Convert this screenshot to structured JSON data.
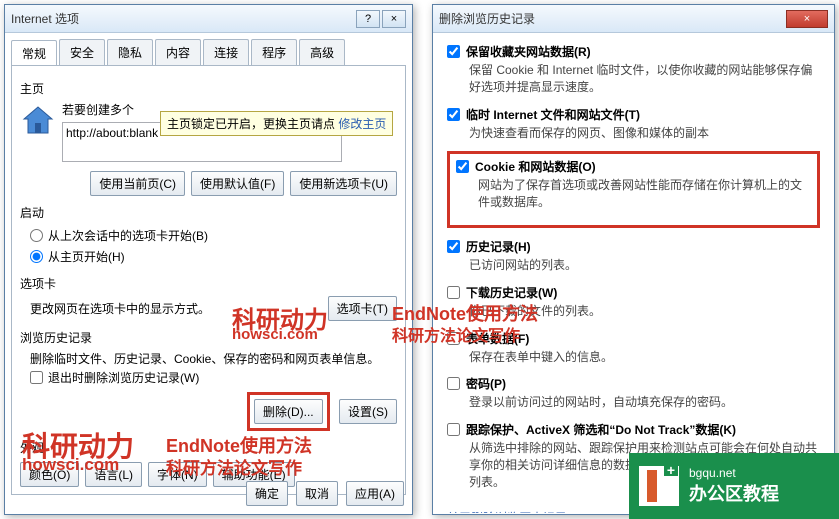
{
  "win1": {
    "title": "Internet 选项",
    "help_icon": "?",
    "close_icon": "×",
    "tabs": [
      "常规",
      "安全",
      "隐私",
      "内容",
      "连接",
      "程序",
      "高级"
    ],
    "homepage": {
      "label": "主页",
      "text": "若要创建多个",
      "tooltip_text": "主页锁定已开启，更换主页请点 ",
      "tooltip_link": "修改主页",
      "value": "http://about:blank",
      "btn_current": "使用当前页(C)",
      "btn_default": "使用默认值(F)",
      "btn_newtab": "使用新选项卡(U)"
    },
    "startup": {
      "label": "启动",
      "opt1": "从上次会话中的选项卡开始(B)",
      "opt2": "从主页开始(H)"
    },
    "tabs_section": {
      "label": "选项卡",
      "text": "更改网页在选项卡中的显示方式。",
      "btn": "选项卡(T)"
    },
    "history": {
      "label": "浏览历史记录",
      "text": "删除临时文件、历史记录、Cookie、保存的密码和网页表单信息。",
      "check": "退出时删除浏览历史记录(W)",
      "btn_delete": "删除(D)...",
      "btn_settings": "设置(S)"
    },
    "appearance": {
      "label": "外观",
      "btn_color": "颜色(O)",
      "btn_lang": "语言(L)",
      "btn_font": "字体(N)",
      "btn_access": "辅助功能(E)"
    },
    "footer": {
      "ok": "确定",
      "cancel": "取消",
      "apply": "应用(A)"
    }
  },
  "win2": {
    "title": "删除浏览历史记录",
    "close_icon": "×",
    "opts": [
      {
        "checked": true,
        "label": "保留收藏夹网站数据(R)",
        "desc": "保留 Cookie 和 Internet 临时文件，以使你收藏的网站能够保存偏好选项并提高显示速度。"
      },
      {
        "checked": true,
        "label": "临时 Internet 文件和网站文件(T)",
        "desc": "为快速查看而保存的网页、图像和媒体的副本"
      },
      {
        "checked": true,
        "label": "Cookie 和网站数据(O)",
        "desc": "网站为了保存首选项或改善网站性能而存储在你计算机上的文件或数据库。",
        "highlight": true
      },
      {
        "checked": true,
        "label": "历史记录(H)",
        "desc": "已访问网站的列表。"
      },
      {
        "checked": false,
        "label": "下载历史记录(W)",
        "desc": "你已下载的文件的列表。"
      },
      {
        "checked": false,
        "label": "表单数据(F)",
        "desc": "保存在表单中键入的信息。"
      },
      {
        "checked": false,
        "label": "密码(P)",
        "desc": "登录以前访问过的网站时，自动填充保存的密码。"
      },
      {
        "checked": false,
        "label": "跟踪保护、ActiveX 筛选和“Do Not Track”数据(K)",
        "desc": "从筛选中排除的网站、跟踪保护用来检测站点可能会在何处自动共享你的相关访问详细信息的数据以及“Do Not Track”请求的例外的列表。"
      }
    ],
    "link": "关于删除浏览历史记录"
  },
  "watermarks": {
    "w1": "科研动力",
    "w1b": "howsci.com",
    "w2": "EndNote使用方法",
    "w2b": "科研方法论文写作",
    "w3": "科研动力",
    "w3b": "howsci.com",
    "w4": "EndNote使用方法",
    "w4b": "科研方法论文写作"
  },
  "brand": {
    "t1": "bgqu.net",
    "t2": "办公区教程"
  }
}
